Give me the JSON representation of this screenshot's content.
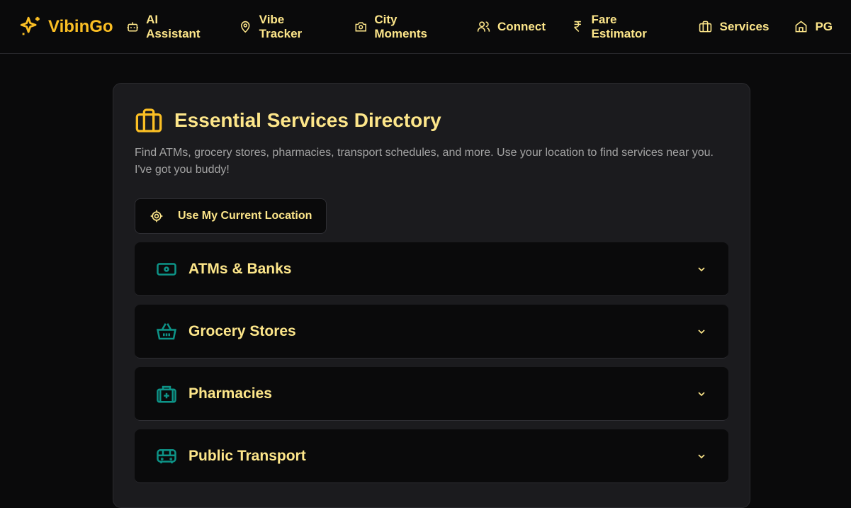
{
  "brand": {
    "name": "VibinGo",
    "icon": "sparkles-icon",
    "color": "#fbbf24"
  },
  "nav": [
    {
      "label": "AI Assistant",
      "icon": "bot-icon"
    },
    {
      "label": "Vibe Tracker",
      "icon": "map-pin-icon"
    },
    {
      "label": "City Moments",
      "icon": "camera-icon"
    },
    {
      "label": "Connect",
      "icon": "users-icon"
    },
    {
      "label": "Fare Estimator",
      "icon": "rupee-icon"
    },
    {
      "label": "Services",
      "icon": "briefcase-icon"
    },
    {
      "label": "PG",
      "icon": "home-icon"
    }
  ],
  "page": {
    "title": "Essential Services Directory",
    "description": "Find ATMs, grocery stores, pharmacies, transport schedules, and more. Use your location to find services near you. I've got you buddy!",
    "location_button": "Use My Current Location"
  },
  "categories": [
    {
      "label": "ATMs & Banks",
      "icon": "banknote-icon"
    },
    {
      "label": "Grocery Stores",
      "icon": "basket-icon"
    },
    {
      "label": "Pharmacies",
      "icon": "medical-bag-icon"
    },
    {
      "label": "Public Transport",
      "icon": "bus-icon"
    }
  ],
  "colors": {
    "accent": "#fbbf24",
    "text": "#fde68a",
    "teal": "#0d9488",
    "background": "#0a0a0b",
    "card": "#1b1b1e"
  }
}
